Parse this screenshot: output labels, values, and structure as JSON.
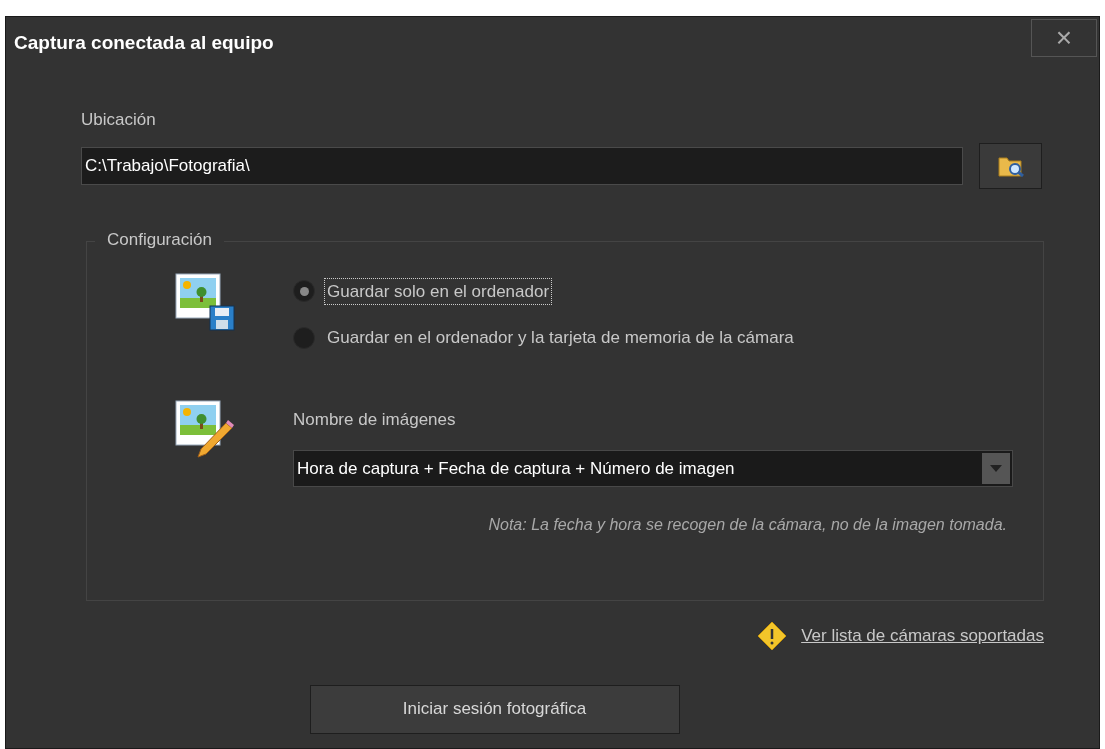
{
  "window": {
    "title": "Captura conectada al equipo",
    "close": "×"
  },
  "location": {
    "label": "Ubicación",
    "value": "C:\\Trabajo\\Fotografia\\"
  },
  "config": {
    "legend": "Configuración",
    "options": [
      {
        "label": "Guardar solo en el ordenador",
        "selected": true
      },
      {
        "label": "Guardar en el ordenador y la tarjeta de memoria de la cámara",
        "selected": false
      }
    ],
    "naming_label": "Nombre de imágenes",
    "naming_value": "Hora de captura + Fecha de captura + Número de imagen",
    "note": "Nota: La fecha y hora se recogen de la cámara, no de la imagen tomada."
  },
  "link": "Ver lista de cámaras soportadas",
  "start_button": "Iniciar sesión fotográfica"
}
